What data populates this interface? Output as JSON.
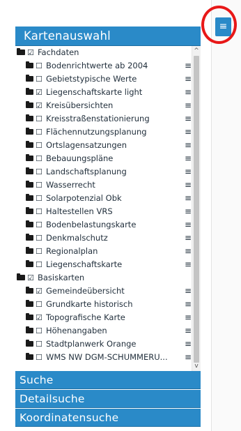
{
  "panel": {
    "title": "Kartenauswahl",
    "sections": [
      "Suche",
      "Detailsuche",
      "Koordinatensuche"
    ]
  },
  "tree": {
    "groups": [
      {
        "label": "Fachdaten",
        "checked": true,
        "layers": [
          {
            "label": "Bodenrichtwerte ab 2004",
            "checked": false
          },
          {
            "label": "Gebietstypische Werte",
            "checked": false
          },
          {
            "label": "Liegenschaftskarte light",
            "checked": true
          },
          {
            "label": "Kreisübersichten",
            "checked": true
          },
          {
            "label": "Kreisstraßenstationierung",
            "checked": false
          },
          {
            "label": "Flächennutzungsplanung",
            "checked": false
          },
          {
            "label": "Ortslagensatzungen",
            "checked": false
          },
          {
            "label": "Bebauungspläne",
            "checked": false
          },
          {
            "label": "Landschaftsplanung",
            "checked": false
          },
          {
            "label": "Wasserrecht",
            "checked": false
          },
          {
            "label": "Solarpotenzial Obk",
            "checked": false
          },
          {
            "label": "Haltestellen VRS",
            "checked": false
          },
          {
            "label": "Bodenbelastungskarte",
            "checked": false
          },
          {
            "label": "Denkmalschutz",
            "checked": false
          },
          {
            "label": "Regionalplan",
            "checked": false
          },
          {
            "label": "Liegenschaftskarte",
            "checked": false
          }
        ]
      },
      {
        "label": "Basiskarten",
        "checked": true,
        "layers": [
          {
            "label": "Gemeindeübersicht",
            "checked": true
          },
          {
            "label": "Grundkarte historisch",
            "checked": false
          },
          {
            "label": "Topografische Karte",
            "checked": true
          },
          {
            "label": "Höhenangaben",
            "checked": false
          },
          {
            "label": "Stadtplanwerk Orange",
            "checked": false
          },
          {
            "label": "WMS NW DGM-SCHUMMERU...",
            "checked": false
          }
        ]
      }
    ]
  },
  "glyphs": {
    "checked": "☑",
    "unchecked": "☐",
    "menu": "≡",
    "toggle": "≡",
    "scroll_up": "^",
    "scroll_down": "v"
  },
  "colors": {
    "accent": "#2a8ac8",
    "highlight_ring": "#e81818"
  }
}
